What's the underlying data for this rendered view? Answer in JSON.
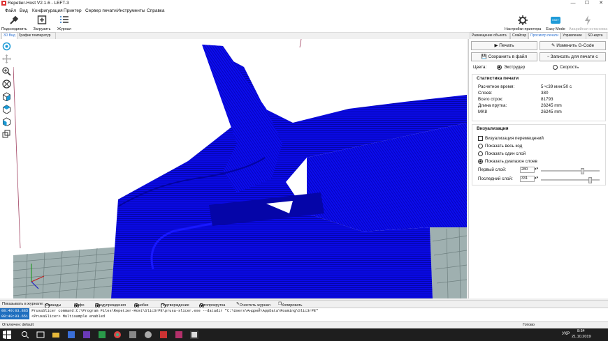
{
  "window": {
    "title": "Repetier-Host V2.1.6 - LEFT-3",
    "controls": [
      "—",
      "☐",
      "✕"
    ]
  },
  "menu": [
    "Файл",
    "Вид",
    "Конфигурация",
    "Принтер",
    "Сервер печати",
    "Инструменты",
    "Справка"
  ],
  "toolbar": {
    "connect": "Подсоединить",
    "load": "Загрузить",
    "log": "Журнал",
    "printer_settings": "Настройки принтера",
    "easy_mode": "Easy Mode",
    "easy_badge": "EASY",
    "emergency_stop": "Аварийная остановка"
  },
  "left_tabs": [
    "3D Вид",
    "График температур"
  ],
  "right_tabs": [
    "Размещение объекта",
    "Слайсер",
    "Просмотр печати",
    "Управление",
    "SD-карта"
  ],
  "preview": {
    "print": "Печать",
    "edit_gcode": "Изменить G-Code",
    "save_file": "Сохранить в файл",
    "save_sd": "Записать для печати с",
    "colors_label": "Цвета:",
    "color_extruder": "Экструдер",
    "color_speed": "Скорость"
  },
  "stats": {
    "title": "Статистика печати",
    "rows": [
      {
        "k": "Расчетное время:",
        "v": "5 ч:39 мин:50 с"
      },
      {
        "k": "Слоев:",
        "v": "380"
      },
      {
        "k": "Всего строк:",
        "v": "81793"
      },
      {
        "k": "Длина прутка:",
        "v": "26245 mm"
      },
      {
        "k": "MK8",
        "v": "26245 mm"
      }
    ]
  },
  "viz": {
    "title": "Визуализация",
    "travel": "Визуализация перемещений",
    "show_all": "Показать весь код",
    "show_one": "Показать один слой",
    "show_range": "Показать диапазон слоев",
    "first_layer_label": "Первый слой:",
    "first_layer": "280",
    "first_layer_fraction": 0.72,
    "last_layer_label": "Последний слой:",
    "last_layer": "331",
    "last_layer_fraction": 0.86
  },
  "logbar": {
    "show_in_log": "Показывать в журнале:",
    "commands": "Команды",
    "info": "Инфо",
    "warnings": "Предупреждения",
    "errors": "Ошибки",
    "confirmations": "Подтверждение",
    "autoscroll": "Автопрокрутка",
    "clear": "Очистить журнал",
    "copy": "Копировать"
  },
  "log": [
    {
      "time": "08:49:03.885",
      "text": "PrusaSlicer command:C:\\Program Files\\Repetier-Host\\Slic3rPE\\prusa-slicer.exe --datadir \"C:\\Users\\АндреЙ\\AppData\\Roaming\\Slic3rPE\""
    },
    {
      "time": "08:49:03.651",
      "text": "<PrusaSlicer> Multisample enabled"
    }
  ],
  "status": {
    "left": "Отключен: default",
    "right": "Готово"
  },
  "taskbar": {
    "lang": "УКР",
    "time": "8:54",
    "date": "21.10.2019"
  },
  "colors": {
    "model_blue": "#0a0ae6",
    "accent": "#1f6fbf"
  }
}
